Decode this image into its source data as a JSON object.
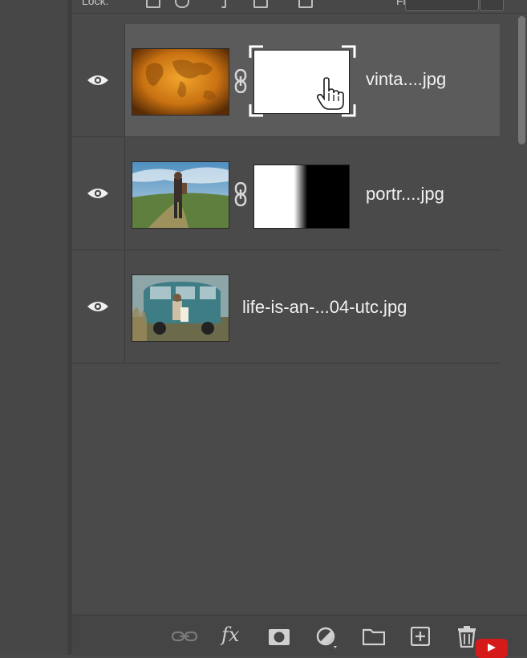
{
  "panel": {
    "top_bar": {
      "lock_label": "Lock:",
      "fill_label": "Fill:"
    },
    "layers": [
      {
        "name": "vinta....jpg",
        "visible": true,
        "selected": true,
        "has_mask": true,
        "mask_style": "solid-white-selected"
      },
      {
        "name": "portr....jpg",
        "visible": true,
        "selected": false,
        "has_mask": true,
        "mask_style": "white-to-black-gradient"
      },
      {
        "name": "life-is-an-...04-utc.jpg",
        "visible": true,
        "selected": false,
        "has_mask": false
      }
    ],
    "bottom_toolbar": {
      "icons": [
        "link-layers-icon",
        "fx-icon",
        "add-mask-icon",
        "adjustment-layer-icon",
        "new-group-icon",
        "new-layer-icon",
        "trash-icon"
      ],
      "fx_label": "fx"
    }
  },
  "colors": {
    "panel_bg": "#4a4a4a",
    "selected_row": "#5b5b5b",
    "text": "#f2f2f2",
    "icon": "#bdbdbd"
  }
}
